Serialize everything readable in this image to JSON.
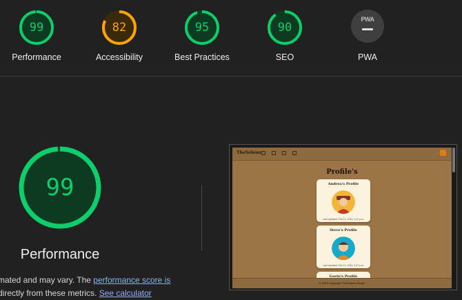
{
  "categories": [
    {
      "label": "Performance",
      "score": "99",
      "value": 99,
      "color": "#0cce6b",
      "bg": "#0f3a22"
    },
    {
      "label": "Accessibility",
      "score": "82",
      "value": 82,
      "color": "#ffa400",
      "bg": "#3a2a0a"
    },
    {
      "label": "Best Practices",
      "score": "95",
      "value": 95,
      "color": "#0cce6b",
      "bg": "#0f3a22"
    },
    {
      "label": "SEO",
      "score": "90",
      "value": 90,
      "color": "#0cce6b",
      "bg": "#0f3a22"
    },
    {
      "label": "PWA",
      "pwa_text": "PWA"
    }
  ],
  "main": {
    "score": "99",
    "value": 99,
    "title": "Performance",
    "desc_prefix": "mated and may vary. The ",
    "desc_link1": "performance score is",
    "desc_line2_prefix": " directly from these metrics. ",
    "desc_link2": "See calculator"
  },
  "screenshot": {
    "site_logo": "TheSolemn",
    "title": "Profile's",
    "cards": [
      {
        "name": "Andrea's Profile",
        "date": "Last Updated: Feb 14, 2024, 1:47 p.m."
      },
      {
        "name": "Steve's Profile",
        "date": "Last Updated: Feb 14, 2024, 9:47 p.m."
      },
      {
        "name": "Gavin's Profile",
        "date": ""
      }
    ],
    "footer": "© 2024 Copyright: TheSolemn Studio"
  }
}
